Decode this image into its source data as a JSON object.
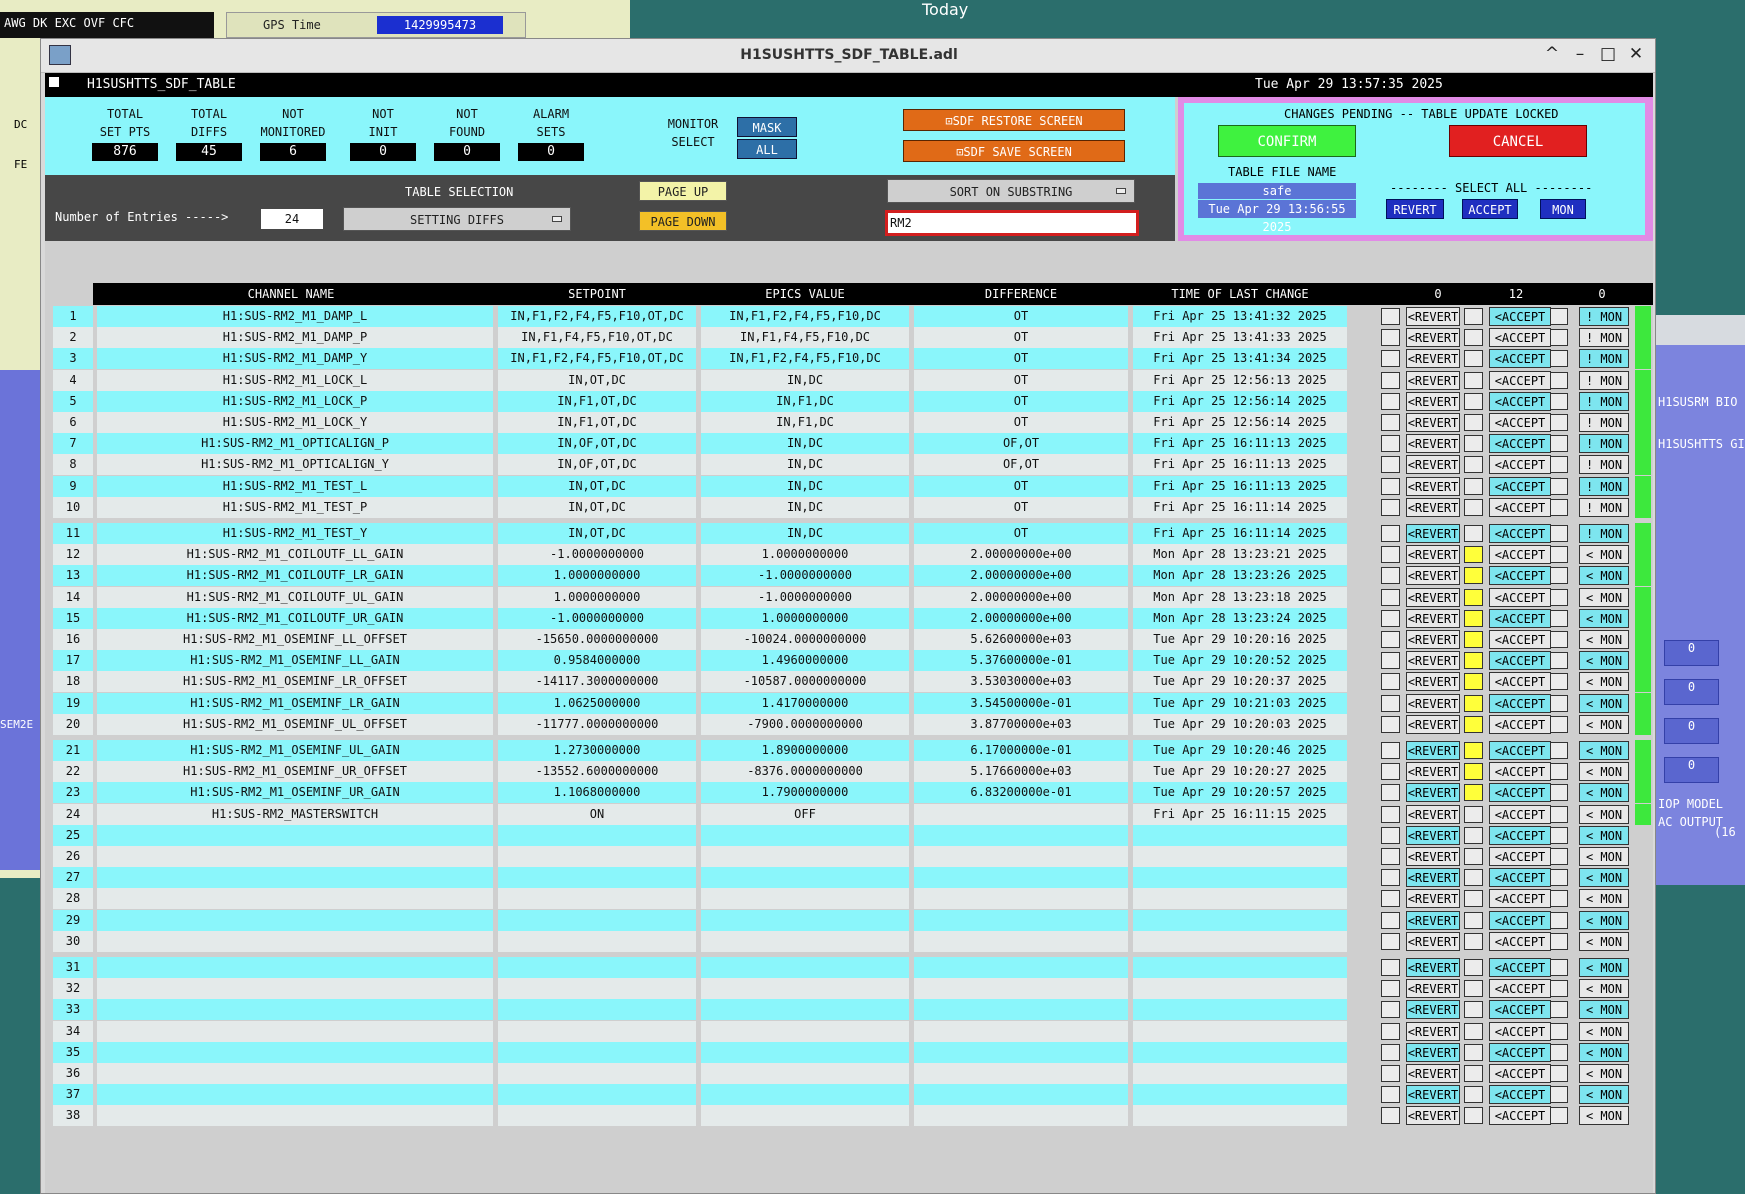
{
  "desktop": {
    "left_menu": [
      "AWG",
      "DK",
      "EXC",
      "OVF",
      "CFC"
    ],
    "gps_label": "GPS Time",
    "gps_value": "1429995473",
    "today_label": "Today",
    "left_labels": [
      "DC",
      "FE"
    ],
    "left_bottom_label": "SEM2E",
    "right_labels": [
      "H1SUSRM BIO",
      "H1SUSHTTS GI",
      "IOP MODEL",
      "AC OUTPUT",
      "(16"
    ],
    "right_values": [
      "0",
      "0",
      "0",
      "0"
    ]
  },
  "window": {
    "title": "H1SUSHTTS_SDF_TABLE.adl",
    "controls": {
      "up": "^",
      "min": "–",
      "max": "□",
      "close": "✕"
    }
  },
  "header": {
    "panel_name": "H1SUSHTTS_SDF_TABLE",
    "datetime": "Tue Apr 29 13:57:35 2025"
  },
  "stats": [
    {
      "label1": "TOTAL",
      "label2": "SET PTS",
      "value": "876"
    },
    {
      "label1": "TOTAL",
      "label2": "DIFFS",
      "value": "45"
    },
    {
      "label1": "NOT",
      "label2": "MONITORED",
      "value": "6"
    },
    {
      "label1": "NOT",
      "label2": "INIT",
      "value": "0"
    },
    {
      "label1": "NOT",
      "label2": "FOUND",
      "value": "0"
    },
    {
      "label1": "ALARM",
      "label2": "SETS",
      "value": "0"
    }
  ],
  "monitor_select": {
    "label1": "MONITOR",
    "label2": "SELECT",
    "mask": "MASK",
    "all": "ALL"
  },
  "sdf_buttons": {
    "restore": "SDF RESTORE SCREEN",
    "save": "SDF SAVE SCREEN"
  },
  "pending": {
    "status": "CHANGES PENDING -- TABLE UPDATE LOCKED",
    "confirm": "CONFIRM",
    "cancel": "CANCEL",
    "file_label": "TABLE FILE NAME",
    "file_name": "safe",
    "file_time": "Tue Apr 29 13:56:55 2025",
    "select_all": "-------- SELECT ALL --------",
    "revert": "REVERT",
    "accept": "ACCEPT",
    "mon": "MON"
  },
  "selection": {
    "title": "TABLE SELECTION",
    "entries_label": "Number of Entries ----->",
    "entries_value": "24",
    "menu_value": "SETTING DIFFS",
    "page_up": "PAGE UP",
    "page_down": "PAGE DOWN",
    "sort_label": "SORT ON SUBSTRING",
    "substring": "RM2"
  },
  "table": {
    "columns": [
      "CHANNEL NAME",
      "SETPOINT",
      "EPICS VALUE",
      "DIFFERENCE",
      "TIME OF LAST CHANGE"
    ],
    "counts": [
      "0",
      "12",
      "0"
    ],
    "rows": [
      {
        "n": "1",
        "name": "H1:SUS-RM2_M1_DAMP_L",
        "set": "IN,F1,F2,F4,F5,F10,OT,DC",
        "epics": "IN,F1,F2,F4,F5,F10,DC",
        "diff": "OT",
        "time": "Fri Apr 25 13:41:32 2025",
        "rev": "<REVERT",
        "acc": "<ACCEPT",
        "mon": "! MON",
        "yc": false,
        "cr": false,
        "ca": true,
        "cm": true
      },
      {
        "n": "2",
        "name": "H1:SUS-RM2_M1_DAMP_P",
        "set": "IN,F1,F4,F5,F10,OT,DC",
        "epics": "IN,F1,F4,F5,F10,DC",
        "diff": "OT",
        "time": "Fri Apr 25 13:41:33 2025",
        "rev": "<REVERT",
        "acc": "<ACCEPT",
        "mon": "! MON",
        "yc": false,
        "cr": false,
        "ca": false,
        "cm": false
      },
      {
        "n": "3",
        "name": "H1:SUS-RM2_M1_DAMP_Y",
        "set": "IN,F1,F2,F4,F5,F10,OT,DC",
        "epics": "IN,F1,F2,F4,F5,F10,DC",
        "diff": "OT",
        "time": "Fri Apr 25 13:41:34 2025",
        "rev": "<REVERT",
        "acc": "<ACCEPT",
        "mon": "! MON",
        "yc": false,
        "cr": false,
        "ca": true,
        "cm": true
      },
      {
        "n": "4",
        "name": "H1:SUS-RM2_M1_LOCK_L",
        "set": "IN,OT,DC",
        "epics": "IN,DC",
        "diff": "OT",
        "time": "Fri Apr 25 12:56:13 2025",
        "rev": "<REVERT",
        "acc": "<ACCEPT",
        "mon": "! MON",
        "yc": false,
        "cr": false,
        "ca": false,
        "cm": false
      },
      {
        "n": "5",
        "name": "H1:SUS-RM2_M1_LOCK_P",
        "set": "IN,F1,OT,DC",
        "epics": "IN,F1,DC",
        "diff": "OT",
        "time": "Fri Apr 25 12:56:14 2025",
        "rev": "<REVERT",
        "acc": "<ACCEPT",
        "mon": "! MON",
        "yc": false,
        "cr": false,
        "ca": true,
        "cm": true
      },
      {
        "n": "6",
        "name": "H1:SUS-RM2_M1_LOCK_Y",
        "set": "IN,F1,OT,DC",
        "epics": "IN,F1,DC",
        "diff": "OT",
        "time": "Fri Apr 25 12:56:14 2025",
        "rev": "<REVERT",
        "acc": "<ACCEPT",
        "mon": "! MON",
        "yc": false,
        "cr": false,
        "ca": false,
        "cm": false
      },
      {
        "n": "7",
        "name": "H1:SUS-RM2_M1_OPTICALIGN_P",
        "set": "IN,OF,OT,DC",
        "epics": "IN,DC",
        "diff": "OF,OT",
        "time": "Fri Apr 25 16:11:13 2025",
        "rev": "<REVERT",
        "acc": "<ACCEPT",
        "mon": "! MON",
        "yc": false,
        "cr": false,
        "ca": true,
        "cm": true
      },
      {
        "n": "8",
        "name": "H1:SUS-RM2_M1_OPTICALIGN_Y",
        "set": "IN,OF,OT,DC",
        "epics": "IN,DC",
        "diff": "OF,OT",
        "time": "Fri Apr 25 16:11:13 2025",
        "rev": "<REVERT",
        "acc": "<ACCEPT",
        "mon": "! MON",
        "yc": false,
        "cr": false,
        "ca": false,
        "cm": false
      },
      {
        "n": "9",
        "name": "H1:SUS-RM2_M1_TEST_L",
        "set": "IN,OT,DC",
        "epics": "IN,DC",
        "diff": "OT",
        "time": "Fri Apr 25 16:11:13 2025",
        "rev": "<REVERT",
        "acc": "<ACCEPT",
        "mon": "! MON",
        "yc": false,
        "cr": false,
        "ca": true,
        "cm": true
      },
      {
        "n": "10",
        "name": "H1:SUS-RM2_M1_TEST_P",
        "set": "IN,OT,DC",
        "epics": "IN,DC",
        "diff": "OT",
        "time": "Fri Apr 25 16:11:14 2025",
        "rev": "<REVERT",
        "acc": "<ACCEPT",
        "mon": "! MON",
        "yc": false,
        "cr": false,
        "ca": false,
        "cm": false
      },
      {
        "n": "11",
        "name": "H1:SUS-RM2_M1_TEST_Y",
        "set": "IN,OT,DC",
        "epics": "IN,DC",
        "diff": "OT",
        "time": "Fri Apr 25 16:11:14 2025",
        "rev": "<REVERT",
        "acc": "<ACCEPT",
        "mon": "! MON",
        "yc": false,
        "cr": true,
        "ca": true,
        "cm": true
      },
      {
        "n": "12",
        "name": "H1:SUS-RM2_M1_COILOUTF_LL_GAIN",
        "set": "-1.0000000000",
        "epics": "1.0000000000",
        "diff": "2.00000000e+00",
        "time": "Mon Apr 28 13:23:21 2025",
        "rev": "<REVERT",
        "acc": "<ACCEPT",
        "mon": "< MON",
        "yc": true,
        "cr": false,
        "ca": false,
        "cm": false
      },
      {
        "n": "13",
        "name": "H1:SUS-RM2_M1_COILOUTF_LR_GAIN",
        "set": "1.0000000000",
        "epics": "-1.0000000000",
        "diff": "2.00000000e+00",
        "time": "Mon Apr 28 13:23:26 2025",
        "rev": "<REVERT",
        "acc": "<ACCEPT",
        "mon": "< MON",
        "yc": true,
        "cr": false,
        "ca": true,
        "cm": true
      },
      {
        "n": "14",
        "name": "H1:SUS-RM2_M1_COILOUTF_UL_GAIN",
        "set": "1.0000000000",
        "epics": "-1.0000000000",
        "diff": "2.00000000e+00",
        "time": "Mon Apr 28 13:23:18 2025",
        "rev": "<REVERT",
        "acc": "<ACCEPT",
        "mon": "< MON",
        "yc": true,
        "cr": false,
        "ca": false,
        "cm": false
      },
      {
        "n": "15",
        "name": "H1:SUS-RM2_M1_COILOUTF_UR_GAIN",
        "set": "-1.0000000000",
        "epics": "1.0000000000",
        "diff": "2.00000000e+00",
        "time": "Mon Apr 28 13:23:24 2025",
        "rev": "<REVERT",
        "acc": "<ACCEPT",
        "mon": "< MON",
        "yc": true,
        "cr": false,
        "ca": true,
        "cm": true
      },
      {
        "n": "16",
        "name": "H1:SUS-RM2_M1_OSEMINF_LL_OFFSET",
        "set": "-15650.0000000000",
        "epics": "-10024.0000000000",
        "diff": "5.62600000e+03",
        "time": "Tue Apr 29 10:20:16 2025",
        "rev": "<REVERT",
        "acc": "<ACCEPT",
        "mon": "< MON",
        "yc": true,
        "cr": false,
        "ca": false,
        "cm": false
      },
      {
        "n": "17",
        "name": "H1:SUS-RM2_M1_OSEMINF_LL_GAIN",
        "set": "0.9584000000",
        "epics": "1.4960000000",
        "diff": "5.37600000e-01",
        "time": "Tue Apr 29 10:20:52 2025",
        "rev": "<REVERT",
        "acc": "<ACCEPT",
        "mon": "< MON",
        "yc": true,
        "cr": false,
        "ca": true,
        "cm": true
      },
      {
        "n": "18",
        "name": "H1:SUS-RM2_M1_OSEMINF_LR_OFFSET",
        "set": "-14117.3000000000",
        "epics": "-10587.0000000000",
        "diff": "3.53030000e+03",
        "time": "Tue Apr 29 10:20:37 2025",
        "rev": "<REVERT",
        "acc": "<ACCEPT",
        "mon": "< MON",
        "yc": true,
        "cr": false,
        "ca": false,
        "cm": false
      },
      {
        "n": "19",
        "name": "H1:SUS-RM2_M1_OSEMINF_LR_GAIN",
        "set": "1.0625000000",
        "epics": "1.4170000000",
        "diff": "3.54500000e-01",
        "time": "Tue Apr 29 10:21:03 2025",
        "rev": "<REVERT",
        "acc": "<ACCEPT",
        "mon": "< MON",
        "yc": true,
        "cr": false,
        "ca": true,
        "cm": true
      },
      {
        "n": "20",
        "name": "H1:SUS-RM2_M1_OSEMINF_UL_OFFSET",
        "set": "-11777.0000000000",
        "epics": "-7900.0000000000",
        "diff": "3.87700000e+03",
        "time": "Tue Apr 29 10:20:03 2025",
        "rev": "<REVERT",
        "acc": "<ACCEPT",
        "mon": "< MON",
        "yc": true,
        "cr": false,
        "ca": false,
        "cm": false
      },
      {
        "n": "21",
        "name": "H1:SUS-RM2_M1_OSEMINF_UL_GAIN",
        "set": "1.2730000000",
        "epics": "1.8900000000",
        "diff": "6.17000000e-01",
        "time": "Tue Apr 29 10:20:46 2025",
        "rev": "<REVERT",
        "acc": "<ACCEPT",
        "mon": "< MON",
        "yc": true,
        "cr": true,
        "ca": true,
        "cm": true
      },
      {
        "n": "22",
        "name": "H1:SUS-RM2_M1_OSEMINF_UR_OFFSET",
        "set": "-13552.6000000000",
        "epics": "-8376.0000000000",
        "diff": "5.17660000e+03",
        "time": "Tue Apr 29 10:20:27 2025",
        "rev": "<REVERT",
        "acc": "<ACCEPT",
        "mon": "< MON",
        "yc": true,
        "cr": false,
        "ca": false,
        "cm": false
      },
      {
        "n": "23",
        "name": "H1:SUS-RM2_M1_OSEMINF_UR_GAIN",
        "set": "1.1068000000",
        "epics": "1.7900000000",
        "diff": "6.83200000e-01",
        "time": "Tue Apr 29 10:20:57 2025",
        "rev": "<REVERT",
        "acc": "<ACCEPT",
        "mon": "< MON",
        "yc": true,
        "cr": true,
        "ca": true,
        "cm": true
      },
      {
        "n": "24",
        "name": "H1:SUS-RM2_MASTERSWITCH",
        "set": "ON",
        "epics": "OFF",
        "diff": "",
        "time": "Fri Apr 25 16:11:15 2025",
        "rev": "<REVERT",
        "acc": "<ACCEPT",
        "mon": "< MON",
        "yc": false,
        "cr": false,
        "ca": false,
        "cm": false
      },
      {
        "n": "25",
        "name": "",
        "set": "",
        "epics": "",
        "diff": "",
        "time": "",
        "rev": "<REVERT",
        "acc": "<ACCEPT",
        "mon": "< MON",
        "yc": false,
        "cr": true,
        "ca": true,
        "cm": true
      },
      {
        "n": "26",
        "name": "",
        "set": "",
        "epics": "",
        "diff": "",
        "time": "",
        "rev": "<REVERT",
        "acc": "<ACCEPT",
        "mon": "< MON",
        "yc": false,
        "cr": false,
        "ca": false,
        "cm": false
      },
      {
        "n": "27",
        "name": "",
        "set": "",
        "epics": "",
        "diff": "",
        "time": "",
        "rev": "<REVERT",
        "acc": "<ACCEPT",
        "mon": "< MON",
        "yc": false,
        "cr": true,
        "ca": true,
        "cm": true
      },
      {
        "n": "28",
        "name": "",
        "set": "",
        "epics": "",
        "diff": "",
        "time": "",
        "rev": "<REVERT",
        "acc": "<ACCEPT",
        "mon": "< MON",
        "yc": false,
        "cr": false,
        "ca": false,
        "cm": false
      },
      {
        "n": "29",
        "name": "",
        "set": "",
        "epics": "",
        "diff": "",
        "time": "",
        "rev": "<REVERT",
        "acc": "<ACCEPT",
        "mon": "< MON",
        "yc": false,
        "cr": true,
        "ca": true,
        "cm": true
      },
      {
        "n": "30",
        "name": "",
        "set": "",
        "epics": "",
        "diff": "",
        "time": "",
        "rev": "<REVERT",
        "acc": "<ACCEPT",
        "mon": "< MON",
        "yc": false,
        "cr": false,
        "ca": false,
        "cm": false
      },
      {
        "n": "31",
        "name": "",
        "set": "",
        "epics": "",
        "diff": "",
        "time": "",
        "rev": "<REVERT",
        "acc": "<ACCEPT",
        "mon": "< MON",
        "yc": false,
        "cr": true,
        "ca": true,
        "cm": true
      },
      {
        "n": "32",
        "name": "",
        "set": "",
        "epics": "",
        "diff": "",
        "time": "",
        "rev": "<REVERT",
        "acc": "<ACCEPT",
        "mon": "< MON",
        "yc": false,
        "cr": false,
        "ca": false,
        "cm": false
      },
      {
        "n": "33",
        "name": "",
        "set": "",
        "epics": "",
        "diff": "",
        "time": "",
        "rev": "<REVERT",
        "acc": "<ACCEPT",
        "mon": "< MON",
        "yc": false,
        "cr": true,
        "ca": true,
        "cm": true
      },
      {
        "n": "34",
        "name": "",
        "set": "",
        "epics": "",
        "diff": "",
        "time": "",
        "rev": "<REVERT",
        "acc": "<ACCEPT",
        "mon": "< MON",
        "yc": false,
        "cr": false,
        "ca": false,
        "cm": false
      },
      {
        "n": "35",
        "name": "",
        "set": "",
        "epics": "",
        "diff": "",
        "time": "",
        "rev": "<REVERT",
        "acc": "<ACCEPT",
        "mon": "< MON",
        "yc": false,
        "cr": true,
        "ca": true,
        "cm": true
      },
      {
        "n": "36",
        "name": "",
        "set": "",
        "epics": "",
        "diff": "",
        "time": "",
        "rev": "<REVERT",
        "acc": "<ACCEPT",
        "mon": "< MON",
        "yc": false,
        "cr": false,
        "ca": false,
        "cm": false
      },
      {
        "n": "37",
        "name": "",
        "set": "",
        "epics": "",
        "diff": "",
        "time": "",
        "rev": "<REVERT",
        "acc": "<ACCEPT",
        "mon": "< MON",
        "yc": false,
        "cr": true,
        "ca": true,
        "cm": true
      },
      {
        "n": "38",
        "name": "",
        "set": "",
        "epics": "",
        "diff": "",
        "time": "",
        "rev": "<REVERT",
        "acc": "<ACCEPT",
        "mon": "< MON",
        "yc": false,
        "cr": false,
        "ca": false,
        "cm": false
      }
    ]
  },
  "colors": {
    "cyan_bg": "#8af6fb",
    "row_alt": "#e4eaea",
    "button_cyan": "#7de5ef",
    "green_status": "#3de83d",
    "yellow_flag": "#ffff3a"
  }
}
